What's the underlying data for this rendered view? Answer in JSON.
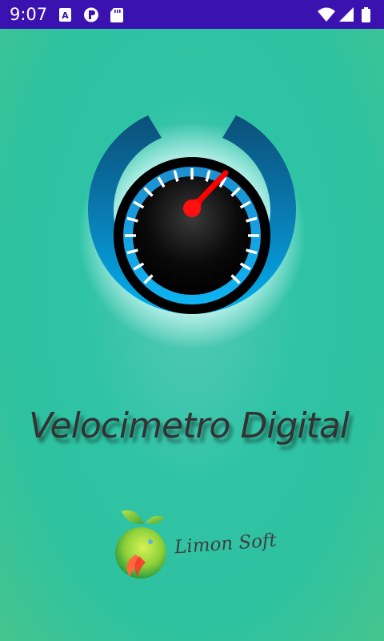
{
  "status_bar": {
    "time": "9:07",
    "left_icons": [
      "accessibility-a-icon",
      "circle-p-icon",
      "sd-card-icon"
    ],
    "right_icons": [
      "wifi-icon",
      "cell-signal-icon",
      "battery-icon"
    ],
    "background_color": "#3a12b0"
  },
  "splash": {
    "app_title": "Velocimetro Digital",
    "brand_name": "Limon Soft",
    "gauge_needle_color": "#ff0000",
    "gauge_ring_color": "#00a6e6"
  }
}
